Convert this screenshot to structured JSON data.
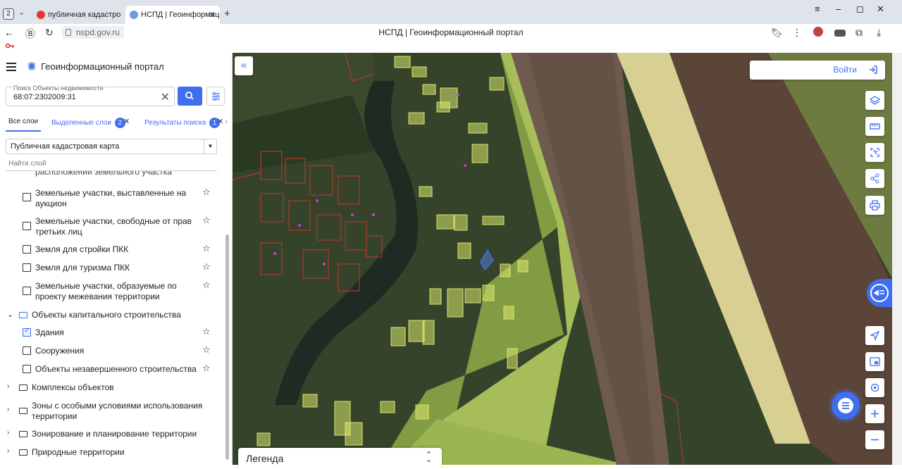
{
  "browser": {
    "tab_count": "2",
    "tabs": [
      {
        "title": "публичная кадастровая к"
      },
      {
        "title": "НСПД | Геоинформаци"
      }
    ],
    "url": "nspd.gov.ru",
    "page_title": "НСПД | Геоинформационный портал"
  },
  "panel": {
    "title": "Геоинформационный портал",
    "search": {
      "label": "Поиск Объекты недвижимости",
      "value": "68:07:2302009:31"
    },
    "tabs": {
      "all": "Все слои",
      "selected": "Выделенные слои",
      "selected_count": "2",
      "results": "Результаты поиска",
      "results_count": "1"
    },
    "map_select": "Публичная кадастровая карта",
    "layer_search_placeholder": "Найти слой",
    "partial_item": "расположении земельного участка",
    "items": [
      {
        "label": "Земельные участки, выставленные на аукцион"
      },
      {
        "label": "Земельные участки, свободные от прав третьих лиц"
      },
      {
        "label": "Земля для стройки ПКК"
      },
      {
        "label": "Земля для туризма ПКК"
      },
      {
        "label": "Земельные участки, образуемые по проекту межевания территории"
      }
    ],
    "group_capital": "Объекты капитального строительства",
    "capital_items": [
      {
        "label": "Здания",
        "checked": true
      },
      {
        "label": "Сооружения",
        "checked": false
      },
      {
        "label": "Объекты незавершенного строительства",
        "checked": false
      }
    ],
    "folders": [
      {
        "label": "Комплексы объектов"
      },
      {
        "label": "Зоны с особыми условиями использования территории"
      },
      {
        "label": "Зонирование и планирование территории"
      },
      {
        "label": "Природные территории"
      }
    ]
  },
  "map": {
    "login": "Войти",
    "legend": "Легенда"
  },
  "colors": {
    "accent": "#3f6ef0",
    "parcel_outline": "#c23a2a",
    "building_fill": "#d8e86a"
  }
}
